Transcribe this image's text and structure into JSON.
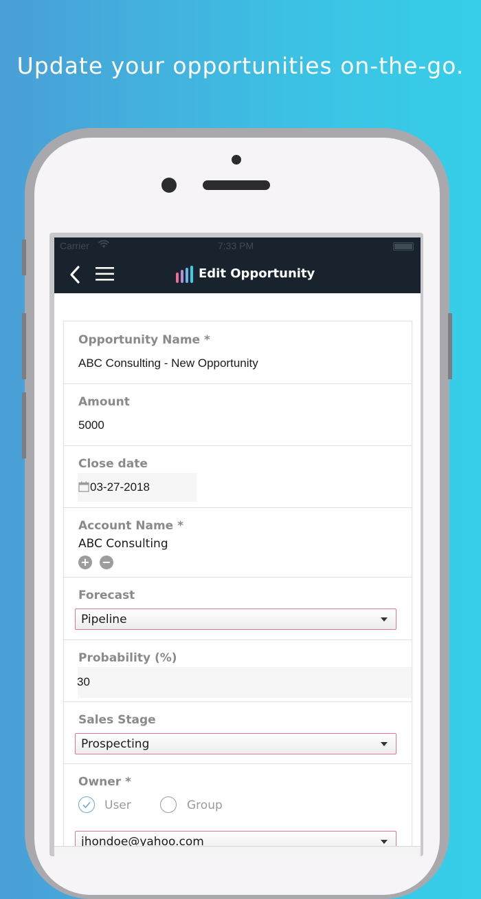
{
  "promo": {
    "headline": "Update your opportunities on-the-go."
  },
  "status_bar": {
    "carrier": "Carrier",
    "time": "7:33 PM"
  },
  "nav": {
    "title": "Edit Opportunity",
    "back_icon": "chevron-left-icon",
    "menu_icon": "hamburger-menu-icon"
  },
  "colors": {
    "nav_bg": "#18232e",
    "select_border": "#e2768a",
    "label": "#8a8a8a",
    "radio_checked": "#6aa7d8"
  },
  "form": {
    "opportunity_name": {
      "label": "Opportunity Name *",
      "value": "ABC Consulting - New Opportunity"
    },
    "amount": {
      "label": "Amount",
      "value": "5000"
    },
    "close_date": {
      "label": "Close date",
      "value": "03-27-2018"
    },
    "account_name": {
      "label": "Account Name *",
      "value": "ABC Consulting",
      "add_symbol": "+",
      "remove_symbol": "−"
    },
    "forecast": {
      "label": "Forecast",
      "selected": "Pipeline"
    },
    "probability": {
      "label": "Probability (%)",
      "value": "30"
    },
    "sales_stage": {
      "label": "Sales Stage",
      "selected": "Prospecting"
    },
    "owner": {
      "label": "Owner *",
      "option_user": "User",
      "option_group": "Group",
      "selected": "User",
      "email": "jhondoe@yahoo.com"
    }
  }
}
